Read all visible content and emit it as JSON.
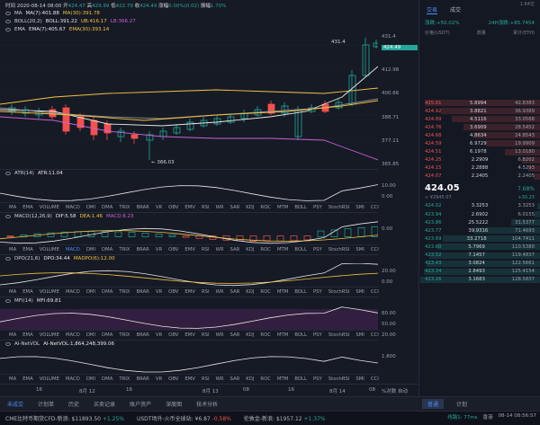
{
  "header": {
    "time_label": "时间 2020-08-14 08:00",
    "open_label": "开",
    "open": "424.47",
    "high_label": "高",
    "high": "429.99",
    "low_label": "低",
    "low": "422.79",
    "close_label": "收",
    "close": "424.49",
    "change_label": "涨幅",
    "change": "0.00%(0.02)",
    "amplitude_label": "振幅",
    "amplitude": "1.70%"
  },
  "main_indicators": [
    {
      "name": "MA",
      "parts": [
        {
          "text": "MA(7):401.88",
          "color": "#e8e8e8"
        },
        {
          "text": "MA(30):391.78",
          "color": "#f5c243"
        }
      ]
    },
    {
      "name": "BOLL(20,2)",
      "parts": [
        {
          "text": "BOLL:391.22",
          "color": "#e8e8e8"
        },
        {
          "text": "UB:416.17",
          "color": "#f5c243"
        },
        {
          "text": "LB:366.27",
          "color": "#c861d6"
        }
      ]
    },
    {
      "name": "EMA",
      "parts": [
        {
          "text": "EMA(7):405.67",
          "color": "#e8e8e8"
        },
        {
          "text": "EMA(30):393.14",
          "color": "#f5c243"
        }
      ]
    }
  ],
  "price_axis": [
    "431.4",
    "424.49",
    "412.98",
    "400.66",
    "388.71",
    "377.11",
    "365.85"
  ],
  "price_marks": {
    "high_label": "431.4",
    "low_label": "366.03"
  },
  "indicator_tabs": [
    "MA",
    "EMA",
    "VOLUME",
    "MACD",
    "DMI",
    "DMA",
    "TRIX",
    "BRAR",
    "VR",
    "OBV",
    "EMV",
    "RSI",
    "WR",
    "SAR",
    "KDJ",
    "ROC",
    "MTM",
    "BOLL",
    "PSY",
    "StochRSI",
    "SMI",
    "CCI"
  ],
  "sub_panes": [
    {
      "id": "atr",
      "label": "ATR(14)",
      "values": [
        {
          "text": "ATR:11.04",
          "color": "#e8e8e8"
        }
      ],
      "axis": [
        "10.00",
        "0.00"
      ],
      "active_tab": "ATR"
    },
    {
      "id": "macd",
      "label": "MACD(12,26,9)",
      "values": [
        {
          "text": "DIF:5.58",
          "color": "#e8e8e8"
        },
        {
          "text": "DEA:1.46",
          "color": "#f5c243"
        },
        {
          "text": "MACD:8.23",
          "color": "#c861d6"
        }
      ],
      "axis": [
        "0.00"
      ],
      "active_tab": "MACD"
    },
    {
      "id": "dpo",
      "label": "DPO(21,6)",
      "values": [
        {
          "text": "DPO:34.44",
          "color": "#e8e8e8"
        },
        {
          "text": "MADPO(6):12.00",
          "color": "#f5c243"
        }
      ],
      "axis": [
        "20.00",
        "0.00"
      ],
      "active_tab": "DPO"
    },
    {
      "id": "mfi",
      "label": "MFI(14)",
      "values": [
        {
          "text": "MFI:69.81",
          "color": "#e8e8e8"
        }
      ],
      "axis": [
        "80.00",
        "50.00",
        "20.00"
      ],
      "active_tab": "MFI"
    },
    {
      "id": "ainet",
      "label": "AI-NetVOL",
      "values": [
        {
          "text": "AI-NetVOL:1,864,248,399.06",
          "color": "#e8e8e8"
        }
      ],
      "axis": [
        "1.800"
      ],
      "active_tab": "AI"
    }
  ],
  "time_axis": [
    "16",
    "8月 12",
    "16",
    "8月 13",
    "08",
    "16",
    "8月 14",
    "08"
  ],
  "time_axis_extra": "%对数 自动",
  "footer_tabs": [
    "未成交",
    "计划单",
    "历史",
    "买卖记录",
    "账户资产",
    "深度图",
    "技术分析"
  ],
  "side": {
    "top_note": "1.64亿",
    "tabs": [
      "交易",
      "成交"
    ],
    "stats": [
      {
        "text": "涨跌:+50.02%",
        "color": "#26a69a"
      },
      {
        "text": "24H涨跌:+85.7454",
        "color": "#26a69a"
      }
    ],
    "columns": [
      "价格(USDT)",
      "数量",
      "累计(ETH)"
    ],
    "asks": [
      [
        "425.01",
        "5.8994",
        "42.8383"
      ],
      [
        "424.92",
        "3.8821",
        "36.9389"
      ],
      [
        "424.89",
        "4.5116",
        "33.0568"
      ],
      [
        "424.76",
        "3.6909",
        "28.5452"
      ],
      [
        "424.68",
        "4.8634",
        "24.8543"
      ],
      [
        "424.59",
        "6.9729",
        "19.9909"
      ],
      [
        "424.51",
        "6.1978",
        "13.0180"
      ],
      [
        "424.25",
        "2.2909",
        "6.8202"
      ],
      [
        "424.15",
        "2.2888",
        "4.5293"
      ],
      [
        "424.07",
        "2.2405",
        "2.2405"
      ]
    ],
    "mid": {
      "price": "424.05",
      "change": "7.68%",
      "sub": "≈ ¥2945.07",
      "sub_change": "+30.23"
    },
    "bids": [
      [
        "424.02",
        "3.3253",
        "3.3253"
      ],
      [
        "423.94",
        "2.6902",
        "6.0155"
      ],
      [
        "423.86",
        "25.5222",
        "31.5377"
      ],
      [
        "423.77",
        "39.9316",
        "71.4693"
      ],
      [
        "423.69",
        "33.2718",
        "104.7411"
      ],
      [
        "423.60",
        "5.7969",
        "110.5380"
      ],
      [
        "423.52",
        "7.1457",
        "119.4837"
      ],
      [
        "423.43",
        "3.0824",
        "122.5661"
      ],
      [
        "423.34",
        "2.8493",
        "125.4154"
      ],
      [
        "423.26",
        "3.1683",
        "128.5837"
      ]
    ],
    "foot_tabs": [
      "普通",
      "计划"
    ]
  },
  "ticker": [
    {
      "text": "CME比特币期货CFD-新浪: $11893.50",
      "change": "+1.25%",
      "color": "#26a69a"
    },
    {
      "text": "USDT场外-火币全球站: ¥6.87",
      "change": "-0.58%",
      "color": "#ef5350"
    },
    {
      "text": "伦敦金-新浪: $1957.12",
      "change": "+1.37%",
      "color": "#26a69a"
    }
  ],
  "status": {
    "latency": "线路1: 77ms",
    "network_label": "香港",
    "clock": "08-14 08:56:57"
  },
  "colors": {
    "up": "#26a69a",
    "down": "#ef5350",
    "ma7": "#e8e8e8",
    "ma30": "#f5c243",
    "lb": "#c861d6",
    "accent": "#4b8ef5"
  }
}
